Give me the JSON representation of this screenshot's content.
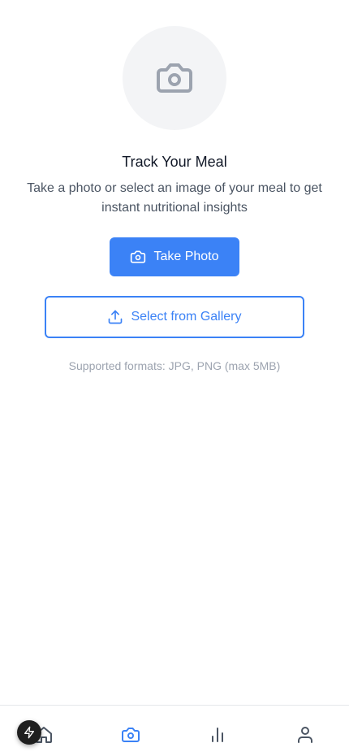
{
  "hero": {
    "icon": "camera-icon",
    "title": "Track Your Meal",
    "subtitle": "Take a photo or select an image of your meal to get instant nutritional insights"
  },
  "actions": {
    "take_photo_label": "Take Photo",
    "take_photo_icon": "camera-icon",
    "gallery_label": "Select from Gallery",
    "gallery_icon": "upload-icon"
  },
  "formats_note": "Supported formats: JPG, PNG (max 5MB)",
  "bottom_nav": {
    "items": [
      {
        "icon": "home-icon",
        "active": false
      },
      {
        "icon": "camera-icon",
        "active": true
      },
      {
        "icon": "bar-chart-icon",
        "active": false
      },
      {
        "icon": "user-icon",
        "active": false
      }
    ],
    "active_color": "#3b82f6",
    "inactive_color": "#4b5563"
  },
  "colors": {
    "primary": "#3b82f6",
    "hero_bg": "#f3f4f6",
    "muted_text": "#9ca3af"
  }
}
